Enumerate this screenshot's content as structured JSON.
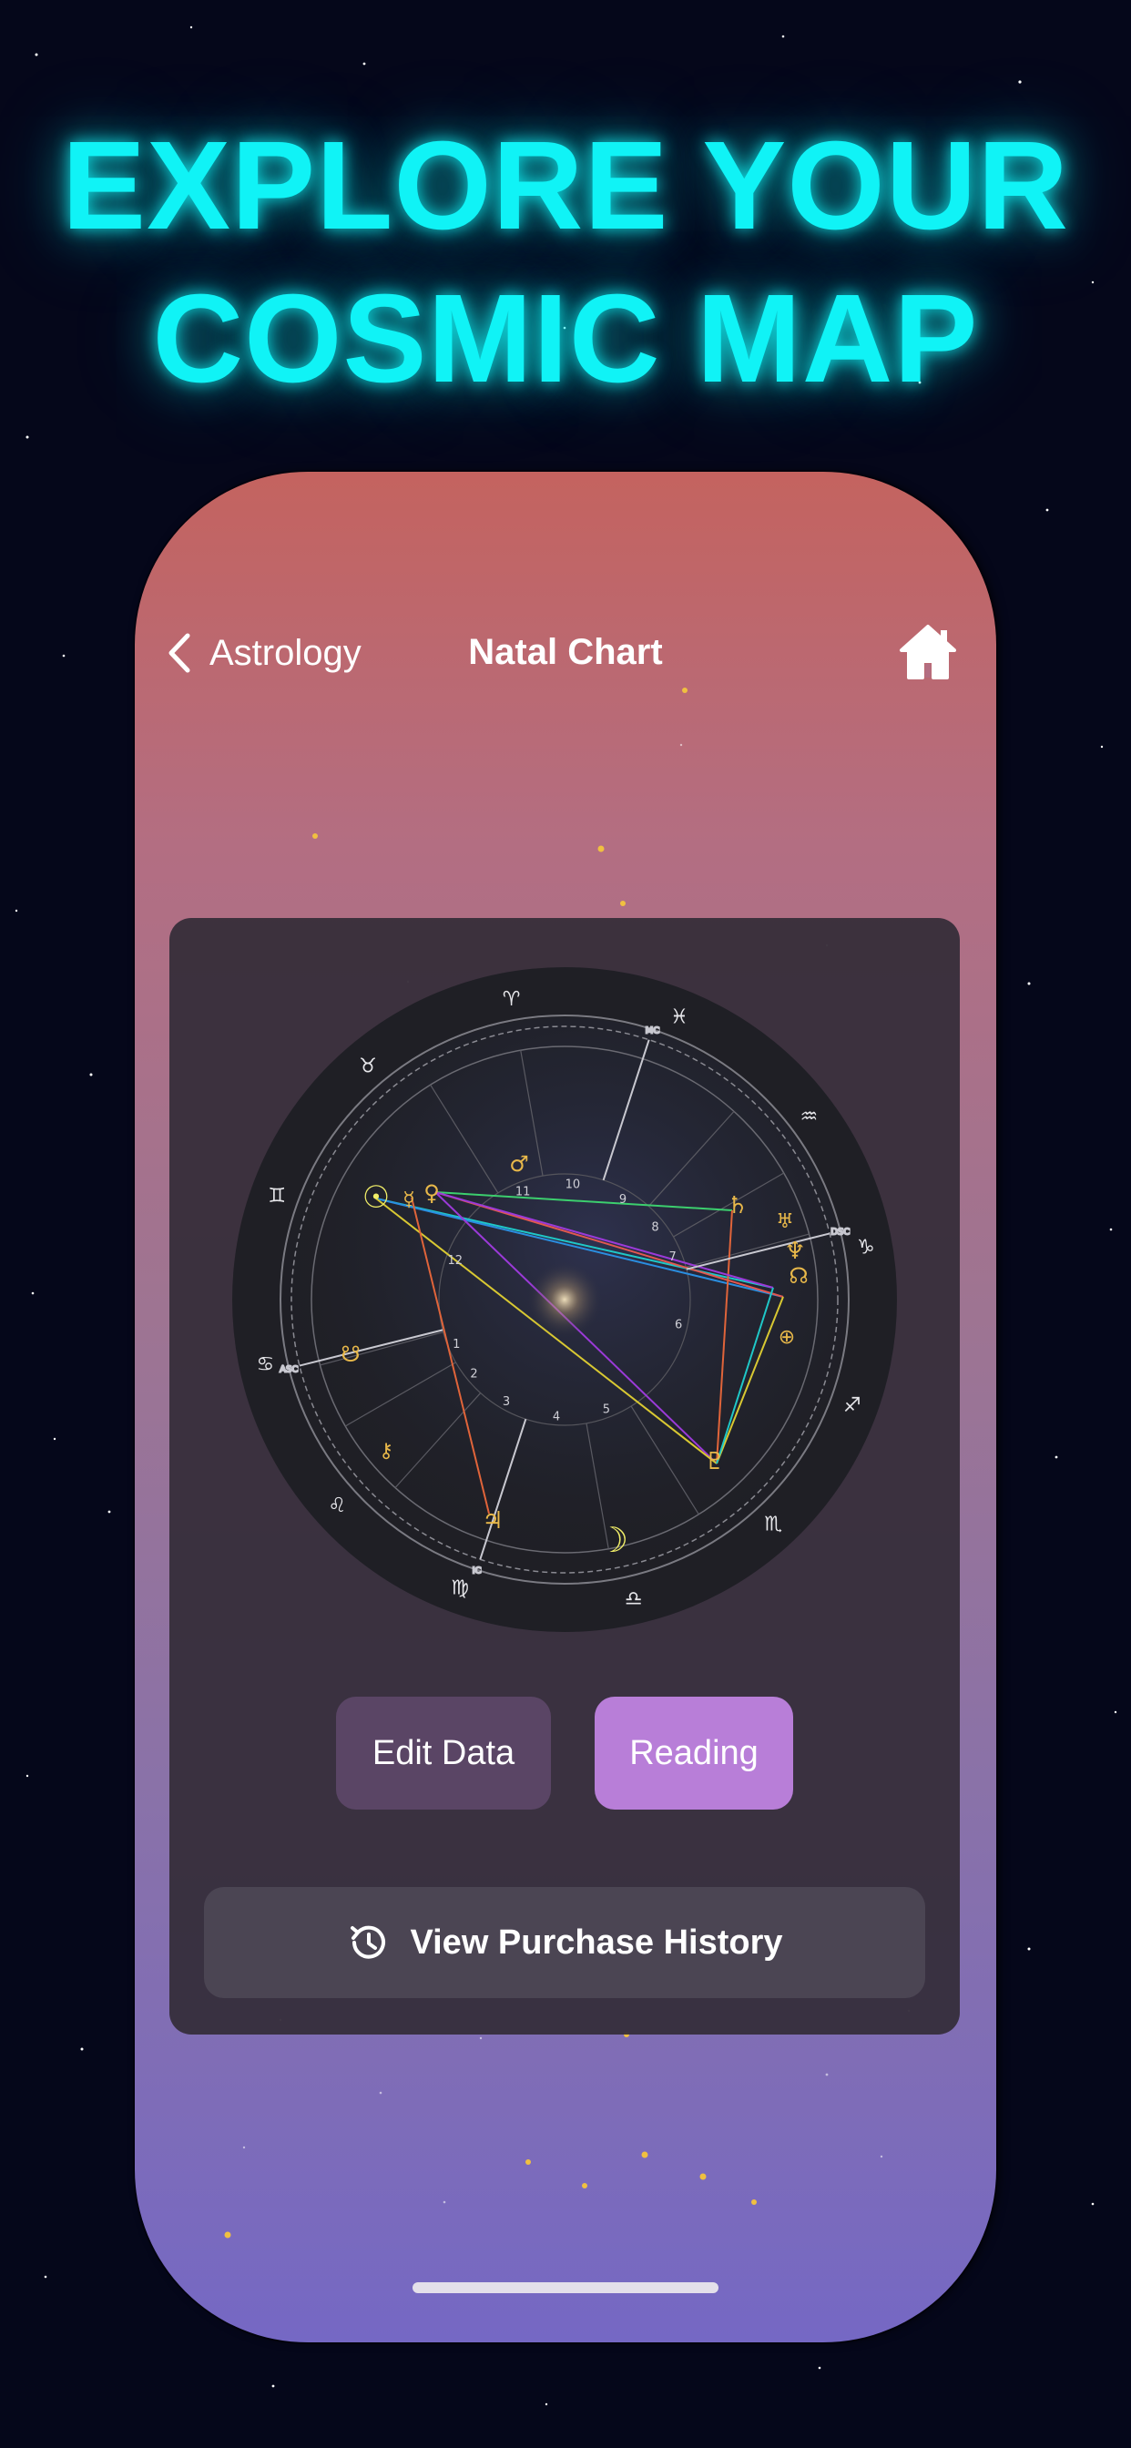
{
  "headline": {
    "line1": "EXPLORE YOUR",
    "line2": "COSMIC MAP"
  },
  "nav": {
    "back_label": "Astrology",
    "title": "Natal Chart"
  },
  "chart": {
    "signs": [
      "♈",
      "♉",
      "♊",
      "♋",
      "♌",
      "♍",
      "♎",
      "♏",
      "♐",
      "♑",
      "♒",
      "♓"
    ],
    "houses": [
      "1",
      "2",
      "3",
      "4",
      "5",
      "6",
      "7",
      "8",
      "9",
      "10",
      "11",
      "12"
    ],
    "angles": {
      "asc": "ASC",
      "mc": "MC",
      "dsc": "DSC",
      "ic": "IC"
    },
    "planets": {
      "sun": "☉",
      "mercury": "☿",
      "venus": "♀",
      "mars": "♂",
      "jupiter": "♃",
      "saturn": "♄",
      "uranus": "♅",
      "neptune": "♆",
      "pluto": "♇",
      "moon": "☽",
      "node": "☊",
      "south_node": "☋",
      "chiron": "⚷",
      "fortune": "⊕"
    },
    "colors": {
      "planet": "#e8b84a",
      "luminary": "#f1ee68",
      "green": "#3ccf6e",
      "red": "#e15850",
      "blue": "#2a8ee0",
      "cyan": "#1fc8c8",
      "purple": "#9b3ad8",
      "orange": "#e0643a",
      "yellow": "#d8c832"
    }
  },
  "buttons": {
    "edit": "Edit Data",
    "reading": "Reading"
  },
  "purchase": {
    "label": "View Purchase History"
  }
}
